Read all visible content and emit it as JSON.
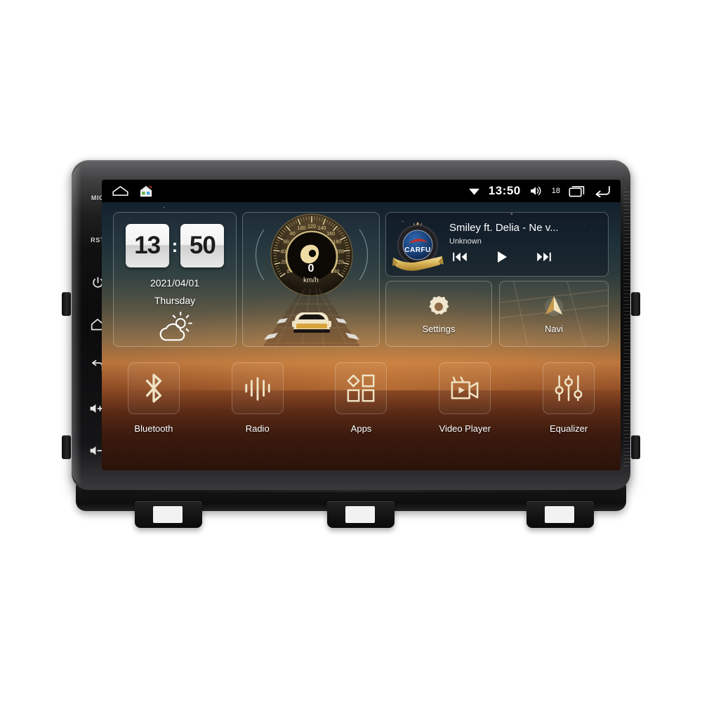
{
  "device": {
    "name": "android-car-head-unit",
    "hard_keys": [
      {
        "name": "mic-key",
        "label": "MIC"
      },
      {
        "name": "reset-key",
        "label": "RST"
      },
      {
        "name": "power-key",
        "icon": "power-icon"
      },
      {
        "name": "home-key",
        "icon": "home-icon"
      },
      {
        "name": "back-key",
        "icon": "back-arrow-icon"
      },
      {
        "name": "volume-up-key",
        "icon": "volume-up-icon"
      },
      {
        "name": "volume-down-key",
        "icon": "volume-down-icon"
      }
    ]
  },
  "statusbar": {
    "left_icons": [
      {
        "name": "home-outline-icon"
      },
      {
        "name": "house-app-icon"
      }
    ],
    "wifi_icon": "wifi-icon",
    "time": "13:50",
    "volume_icon": "volume-icon",
    "volume_level": "18",
    "recents_icon": "recents-icon",
    "back_icon": "back-icon"
  },
  "clock_widget": {
    "hours": "13",
    "minutes": "50",
    "separator": ":",
    "date": "2021/04/01",
    "weekday": "Thursday",
    "weather_icon": "partly-cloudy-icon"
  },
  "speed_widget": {
    "value": "0",
    "unit": "km/h",
    "ticks": [
      "0",
      "20",
      "40",
      "60",
      "80",
      "100",
      "120",
      "140",
      "160",
      "180",
      "200",
      "220",
      "240"
    ],
    "accent_color": "#e8cf8f"
  },
  "music_widget": {
    "logo_text": "CARFU",
    "track": "Smiley ft. Delia - Ne v...",
    "artist": "Unknown",
    "controls": [
      {
        "name": "previous-track-button",
        "icon": "prev-icon"
      },
      {
        "name": "play-button",
        "icon": "play-icon"
      },
      {
        "name": "next-track-button",
        "icon": "next-icon"
      }
    ]
  },
  "tiles": [
    {
      "name": "settings-tile",
      "label": "Settings",
      "icon": "gear-icon"
    },
    {
      "name": "navi-tile",
      "label": "Navi",
      "icon": "navigation-arrow-icon"
    }
  ],
  "dock": [
    {
      "name": "bluetooth-tile",
      "label": "Bluetooth",
      "icon": "bluetooth-icon"
    },
    {
      "name": "radio-tile",
      "label": "Radio",
      "icon": "radio-waveform-icon"
    },
    {
      "name": "apps-tile",
      "label": "Apps",
      "icon": "apps-grid-icon"
    },
    {
      "name": "video-player-tile",
      "label": "Video Player",
      "icon": "video-camera-icon"
    },
    {
      "name": "equalizer-tile",
      "label": "Equalizer",
      "icon": "equalizer-sliders-icon"
    }
  ],
  "colors": {
    "gold": "#e8cf8f",
    "sunset": "#b9743c",
    "night": "#15232f",
    "badge_blue": "#1b3f78"
  }
}
